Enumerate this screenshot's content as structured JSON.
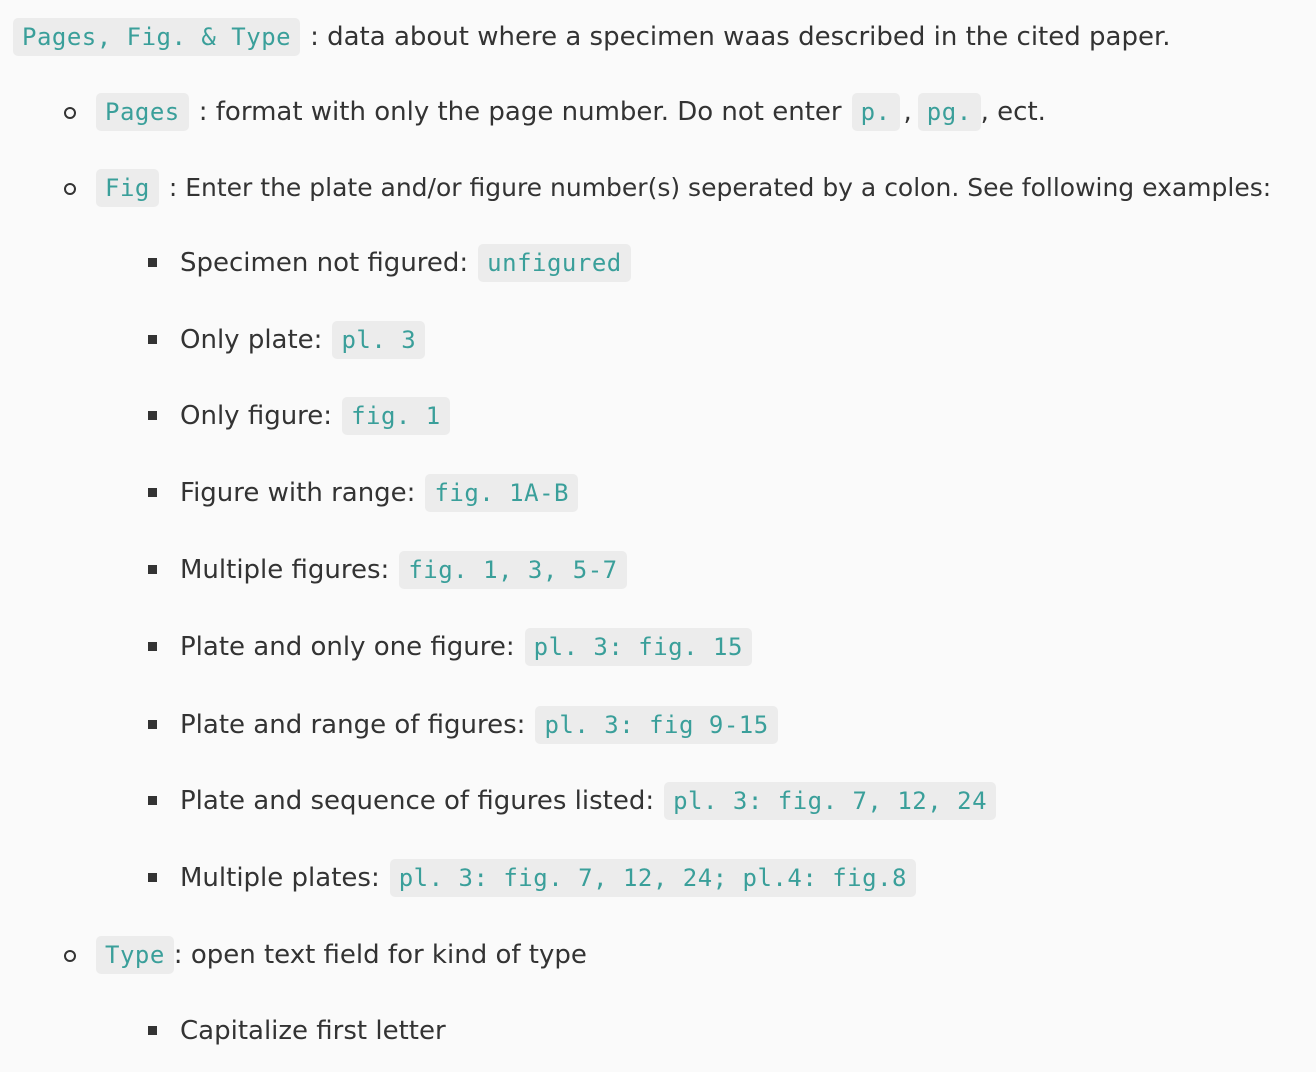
{
  "intro": {
    "code": "Pages, Fig. & Type",
    "text": ": data about where a specimen waas described in the cited paper."
  },
  "pages_item": {
    "code": "Pages",
    "text_before": ": format with only the page number. Do not enter",
    "code_p": "p.",
    "comma": ",",
    "code_pg": "pg.",
    "text_after": ", ect."
  },
  "fig_item": {
    "code": "Fig",
    "text": ": Enter the plate and/or figure number(s) seperated by a colon. See following examples:",
    "examples": [
      {
        "label": "Specimen not figured:",
        "code": "unfigured"
      },
      {
        "label": "Only plate:",
        "code": "pl. 3"
      },
      {
        "label": "Only figure:",
        "code": "fig. 1"
      },
      {
        "label": "Figure with range:",
        "code": "fig. 1A-B"
      },
      {
        "label": "Multiple figures:",
        "code": "fig. 1, 3, 5-7"
      },
      {
        "label": "Plate and only one figure:",
        "code": "pl. 3: fig. 15"
      },
      {
        "label": "Plate and range of figures:",
        "code": "pl. 3: fig 9-15"
      },
      {
        "label": "Plate and sequence of figures listed:",
        "code": "pl. 3: fig. 7, 12, 24"
      },
      {
        "label": "Multiple plates:",
        "code": "pl. 3: fig. 7, 12, 24; pl.4: fig.8"
      }
    ]
  },
  "type_item": {
    "code": "Type",
    "text": ": open text field for kind of type",
    "sub": [
      "Capitalize first letter"
    ]
  },
  "colors": {
    "code_text": "#3a9f9a",
    "code_bg": "#ececec",
    "body_text": "#333333",
    "background": "#fafafa"
  }
}
